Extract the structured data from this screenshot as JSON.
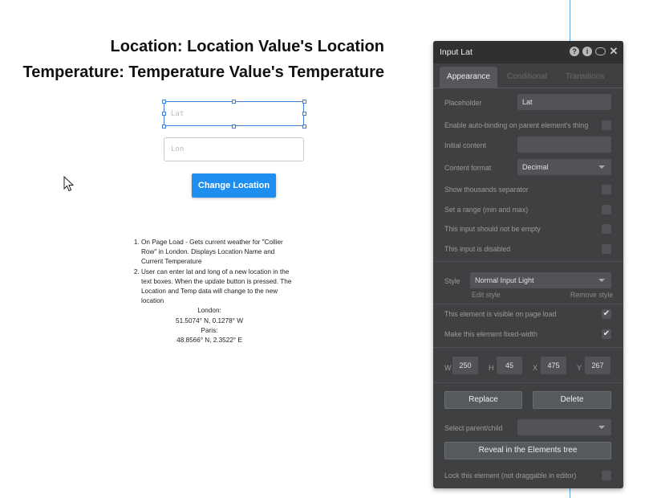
{
  "canvas": {
    "heading_location": "Location: Location Value's Location",
    "heading_temperature": "Temperature:  Temperature Value's Temperature",
    "lat_placeholder": "Lat",
    "lon_placeholder": "Lon",
    "change_button": "Change Location",
    "instructions": {
      "item1": "On Page Load - Gets current weather for \"Collier Row\" in London. Displays Location Name and Current Temperature",
      "item2": "User can enter lat and long of a new location in the text boxes. When the update button is pressed. The Location and Temp data will change to the new location",
      "london_label": "London:",
      "london_coords": "51.5074° N, 0.1278° W",
      "paris_label": "Paris:",
      "paris_coords": "48.8566° N, 2.3522° E"
    }
  },
  "panel": {
    "title": "Input Lat",
    "icons": [
      "help-icon",
      "info-icon",
      "comment-icon",
      "close-icon"
    ],
    "tabs": [
      "Appearance",
      "Conditional",
      "Transitions"
    ],
    "placeholder_label": "Placeholder",
    "placeholder_value": "Lat",
    "autobinding_label": "Enable auto-binding on parent element's thing",
    "initial_content_label": "Initial content",
    "content_format_label": "Content format",
    "content_format_value": "Decimal",
    "thousands_label": "Show thousands separator",
    "range_label": "Set a range (min and max)",
    "not_empty_label": "This input should not be empty",
    "disabled_label": "This input is disabled",
    "style_label": "Style",
    "style_value": "Normal Input Light",
    "edit_style": "Edit style",
    "remove_style": "Remove style",
    "visible_label": "This element is visible on page load",
    "fixed_width_label": "Make this element fixed-width",
    "check_mark": "✔",
    "w_label": "W",
    "w_value": "250",
    "h_label": "H",
    "h_value": "45",
    "x_label": "X",
    "x_value": "475",
    "y_label": "Y",
    "y_value": "267",
    "replace_button": "Replace",
    "delete_button": "Delete",
    "select_parent_label": "Select parent/child",
    "reveal_button": "Reveal in the Elements tree",
    "lock_label": "Lock this element (not draggable in editor)"
  }
}
